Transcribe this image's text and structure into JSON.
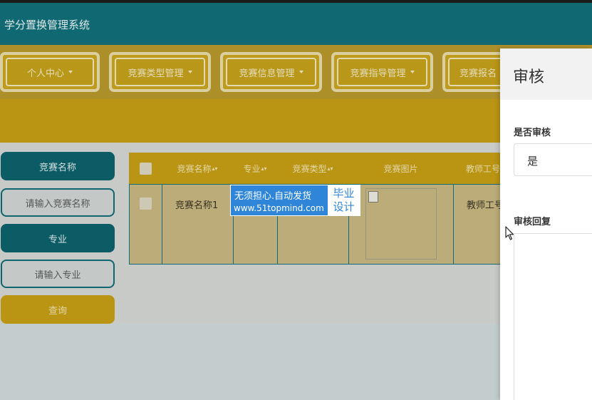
{
  "app": {
    "title": "学分置换管理系统"
  },
  "nav": {
    "items": [
      {
        "label": "个人中心"
      },
      {
        "label": "竞赛类型管理"
      },
      {
        "label": "竞赛信息管理"
      },
      {
        "label": "竞赛指导管理"
      },
      {
        "label": "竞赛报名"
      }
    ]
  },
  "search": {
    "name_label": "竞赛名称",
    "name_placeholder": "请输入竞赛名称",
    "major_label": "专业",
    "major_placeholder": "请输入专业",
    "query_button": "查询"
  },
  "table": {
    "headers": [
      "竞赛名称",
      "专业",
      "竞赛类型",
      "竞赛图片",
      "教师工号"
    ],
    "rows": [
      {
        "name": "竞赛名称1",
        "major": "",
        "type": "",
        "image": "",
        "teacher_id": "教师工号"
      }
    ]
  },
  "watermark": {
    "line1": "无须担心.自动发货",
    "line2": "www.51topmind.com",
    "side_line1": "毕业",
    "side_line2": "设计"
  },
  "drawer": {
    "title": "审核",
    "review_label": "是否审核",
    "review_value": "是",
    "reply_label": "审核回复"
  },
  "colors": {
    "topbar": "#116d77",
    "accent_gold": "#c49a12",
    "teal_dark": "#0c5f68",
    "watermark_blue": "#2f86d8"
  }
}
